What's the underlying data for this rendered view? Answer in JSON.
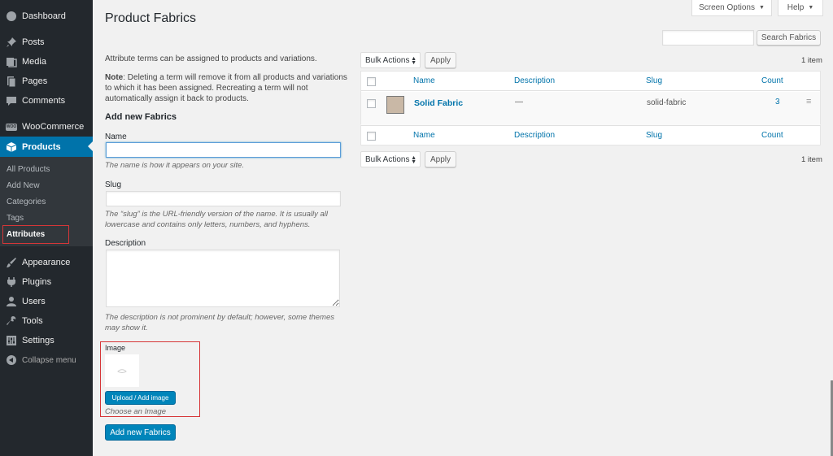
{
  "sidebar": {
    "menu": [
      {
        "label": "Dashboard",
        "icon": "dashboard-icon"
      },
      {
        "label": "Posts",
        "icon": "pin-icon"
      },
      {
        "label": "Media",
        "icon": "media-icon"
      },
      {
        "label": "Pages",
        "icon": "pages-icon"
      },
      {
        "label": "Comments",
        "icon": "comment-icon"
      },
      {
        "label": "WooCommerce",
        "icon": "woocommerce-icon"
      },
      {
        "label": "Products",
        "icon": "products-icon"
      },
      {
        "label": "Appearance",
        "icon": "brush-icon"
      },
      {
        "label": "Plugins",
        "icon": "plugin-icon"
      },
      {
        "label": "Users",
        "icon": "user-icon"
      },
      {
        "label": "Tools",
        "icon": "wrench-icon"
      },
      {
        "label": "Settings",
        "icon": "settings-icon"
      },
      {
        "label": "Collapse menu",
        "icon": "collapse-icon"
      }
    ],
    "woo_badge": "WOO",
    "submenu": [
      "All Products",
      "Add New",
      "Categories",
      "Tags",
      "Attributes"
    ]
  },
  "topbar": {
    "screen_options": "Screen Options",
    "help": "Help"
  },
  "page_title": "Product Fabrics",
  "search": {
    "value": "",
    "button": "Search Fabrics"
  },
  "form": {
    "intro": "Attribute terms can be assigned to products and variations.",
    "note_label": "Note",
    "note_text": ": Deleting a term will remove it from all products and variations to which it has been assigned. Recreating a term will not automatically assign it back to products.",
    "heading": "Add new Fabrics",
    "name_label": "Name",
    "name_help": "The name is how it appears on your site.",
    "slug_label": "Slug",
    "slug_help": "The “slug” is the URL-friendly version of the name. It is usually all lowercase and contains only letters, numbers, and hyphens.",
    "description_label": "Description",
    "description_help": "The description is not prominent by default; however, some themes may show it.",
    "image_label": "Image",
    "upload_button": "Upload / Add image",
    "image_help": "Choose an Image",
    "submit": "Add new Fabrics"
  },
  "table": {
    "bulk_actions": "Bulk Actions",
    "apply": "Apply",
    "item_count": "1 item",
    "columns": [
      "Name",
      "Description",
      "Slug",
      "Count"
    ],
    "rows": [
      {
        "name": "Solid Fabric",
        "description": "—",
        "slug": "solid-fabric",
        "count": "3",
        "swatch_color": "#c9b8a6"
      }
    ]
  },
  "colors": {
    "accent": "#0073aa",
    "sidebar": "#23282d",
    "highlight": "#d63638"
  }
}
